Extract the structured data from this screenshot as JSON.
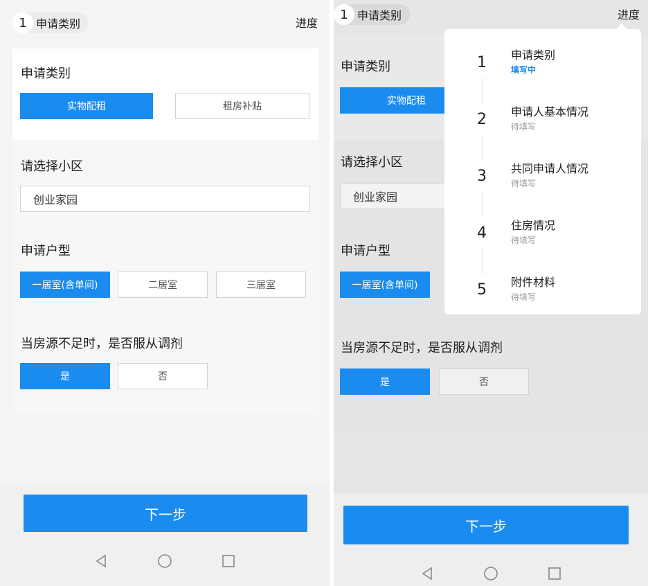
{
  "header": {
    "step_number": "1",
    "step_title": "申请类别",
    "progress_link": "进度"
  },
  "form": {
    "category": {
      "label": "申请类别",
      "options": [
        "实物配租",
        "租房补贴"
      ],
      "selected": "实物配租"
    },
    "community": {
      "label": "请选择小区",
      "value": "创业家园"
    },
    "house_type": {
      "label": "申请户型",
      "options": [
        "一居室(含单间)",
        "二居室",
        "三居室"
      ],
      "selected": "一居室(含单间)"
    },
    "adjust": {
      "label": "当房源不足时，是否服从调剂",
      "options": [
        "是",
        "否"
      ],
      "selected": "是"
    }
  },
  "next_button": "下一步",
  "progress_popup": {
    "steps": [
      {
        "number": "1",
        "title": "申请类别",
        "status": "填写中"
      },
      {
        "number": "2",
        "title": "申请人基本情况",
        "status": "待填写"
      },
      {
        "number": "3",
        "title": "共同申请人情况",
        "status": "待填写"
      },
      {
        "number": "4",
        "title": "住房情况",
        "status": "待填写"
      },
      {
        "number": "5",
        "title": "附件材料",
        "status": "待填写"
      }
    ]
  },
  "colors": {
    "accent": "#1a8cf0",
    "background": "#f5f5f5",
    "overlay_background": "#e6e6e6"
  },
  "icons": [
    "back-icon",
    "home-icon",
    "recents-icon"
  ]
}
